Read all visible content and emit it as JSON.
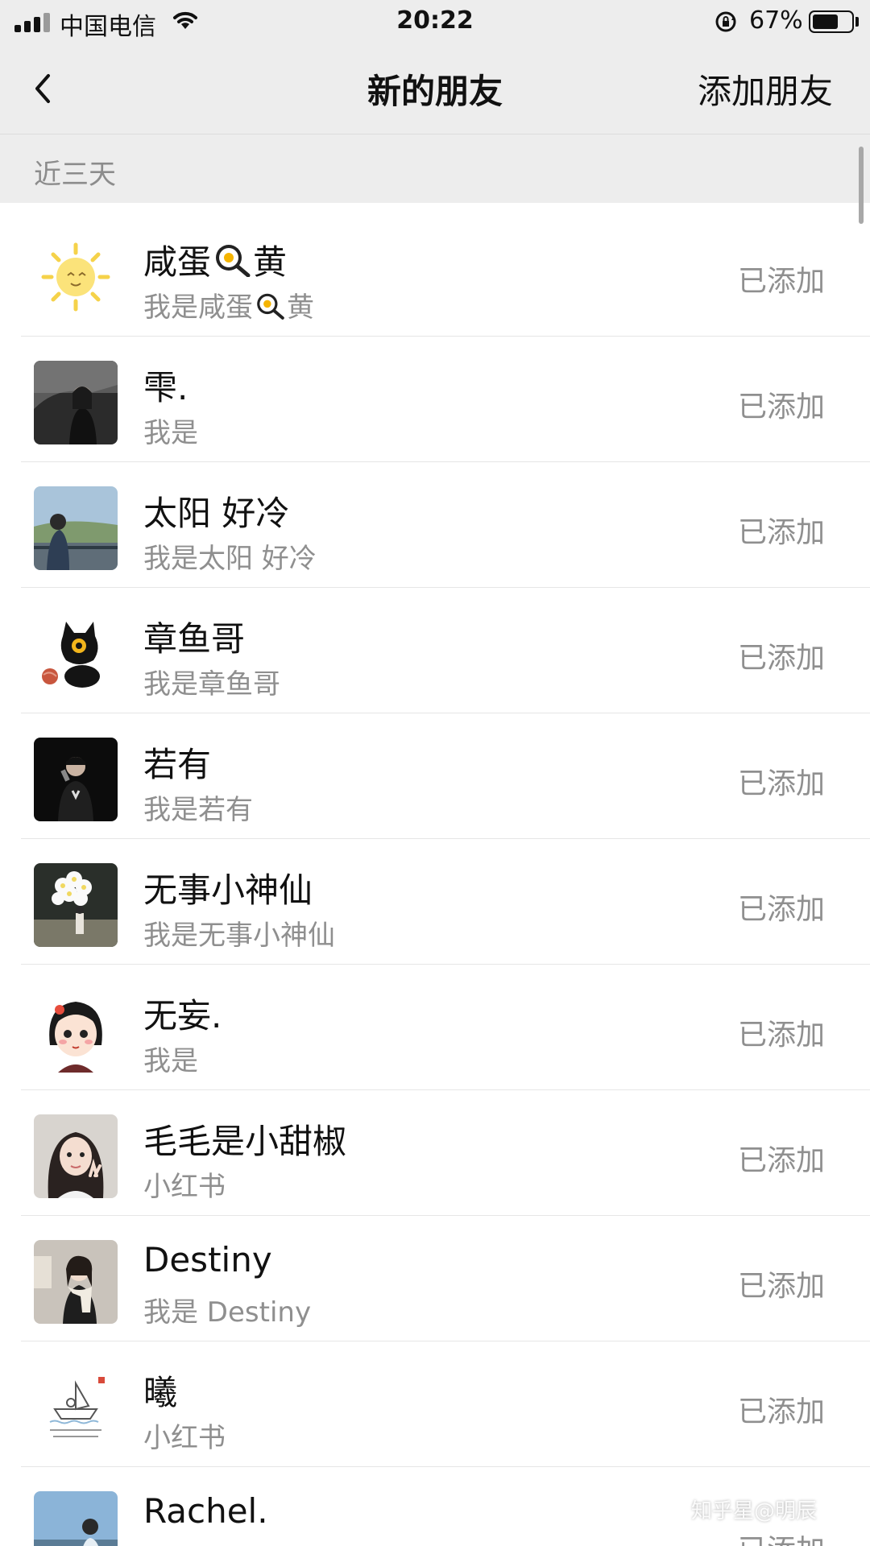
{
  "status_bar": {
    "carrier": "中国电信",
    "time": "20:22",
    "battery_percent": "67%",
    "battery_level": 0.67,
    "icons": [
      "signal-icon",
      "wifi-icon",
      "orientation-lock-icon",
      "battery-icon"
    ]
  },
  "nav": {
    "back_icon": "chevron-left-icon",
    "title": "新的朋友",
    "action_label": "添加朋友"
  },
  "section": {
    "label": "近三天"
  },
  "friends": [
    {
      "name_pre": "咸蛋",
      "name_post": "黄",
      "name_icon": "fried-egg-pan-icon",
      "msg_pre": "我是咸蛋",
      "msg_post": "黄",
      "msg_icon": "fried-egg-pan-icon",
      "status": "已添加",
      "avatar": "sun-sticker-avatar"
    },
    {
      "name": "雫.",
      "msg": "我是",
      "status": "已添加",
      "avatar": "girl-in-car-photo-avatar"
    },
    {
      "name": "太阳 好冷",
      "msg": "我是太阳 好冷",
      "status": "已添加",
      "avatar": "girl-on-balcony-photo-avatar"
    },
    {
      "name": "章鱼哥",
      "msg": "我是章鱼哥",
      "status": "已添加",
      "avatar": "black-cat-plush-avatar"
    },
    {
      "name": "若有",
      "msg": "我是若有",
      "status": "已添加",
      "avatar": "man-with-microphone-photo-avatar"
    },
    {
      "name": "无事小神仙",
      "msg": "我是无事小神仙",
      "status": "已添加",
      "avatar": "balloons-girl-photo-avatar"
    },
    {
      "name": "无妄.",
      "msg": "我是",
      "status": "已添加",
      "avatar": "cartoon-girl-avatar"
    },
    {
      "name": "毛毛是小甜椒",
      "msg": "小红书",
      "status": "已添加",
      "avatar": "selfie-girl-photo-avatar"
    },
    {
      "name": "Destiny",
      "msg": "我是 Destiny",
      "status": "已添加",
      "avatar": "girl-with-scarf-photo-avatar"
    },
    {
      "name": "曦",
      "msg": "小红书",
      "status": "已添加",
      "avatar": "sketch-boat-illustration-avatar"
    },
    {
      "name": "Rachel.",
      "msg": "",
      "status": "已添加",
      "avatar": "sky-photo-avatar"
    }
  ],
  "watermark": "知乎星@明辰",
  "colors": {
    "bar_bg": "#ededed",
    "secondary_text": "#8f8f8f",
    "divider": "#e6e6e6"
  }
}
